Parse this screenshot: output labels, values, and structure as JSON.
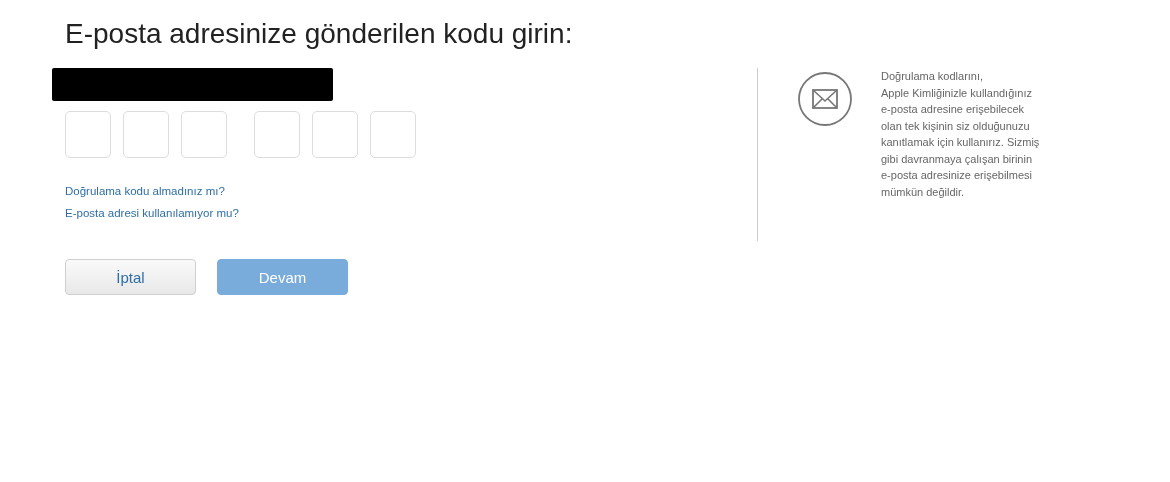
{
  "title": "E-posta adresinize gönderilen kodu girin:",
  "links": [
    "Doğrulama kodu almadınız mı?",
    "E-posta adresi kullanılamıyor mu?"
  ],
  "buttons": [
    {
      "label": "İptal",
      "disabled": false
    },
    {
      "label": "Devam",
      "disabled": true
    }
  ],
  "info": {
    "lines": [
      "Doğrulama kodlarını,",
      "Apple Kimliğinizle kullandığınız",
      "e-posta adresine erişebilecek",
      "olan tek kişinin siz olduğunuzu",
      "kanıtlamak için kullanırız. Sizmiş",
      "gibi davranmaya çalışan birinin",
      "e-posta adresinize erişebilmesi",
      "mümkün değildir."
    ]
  }
}
